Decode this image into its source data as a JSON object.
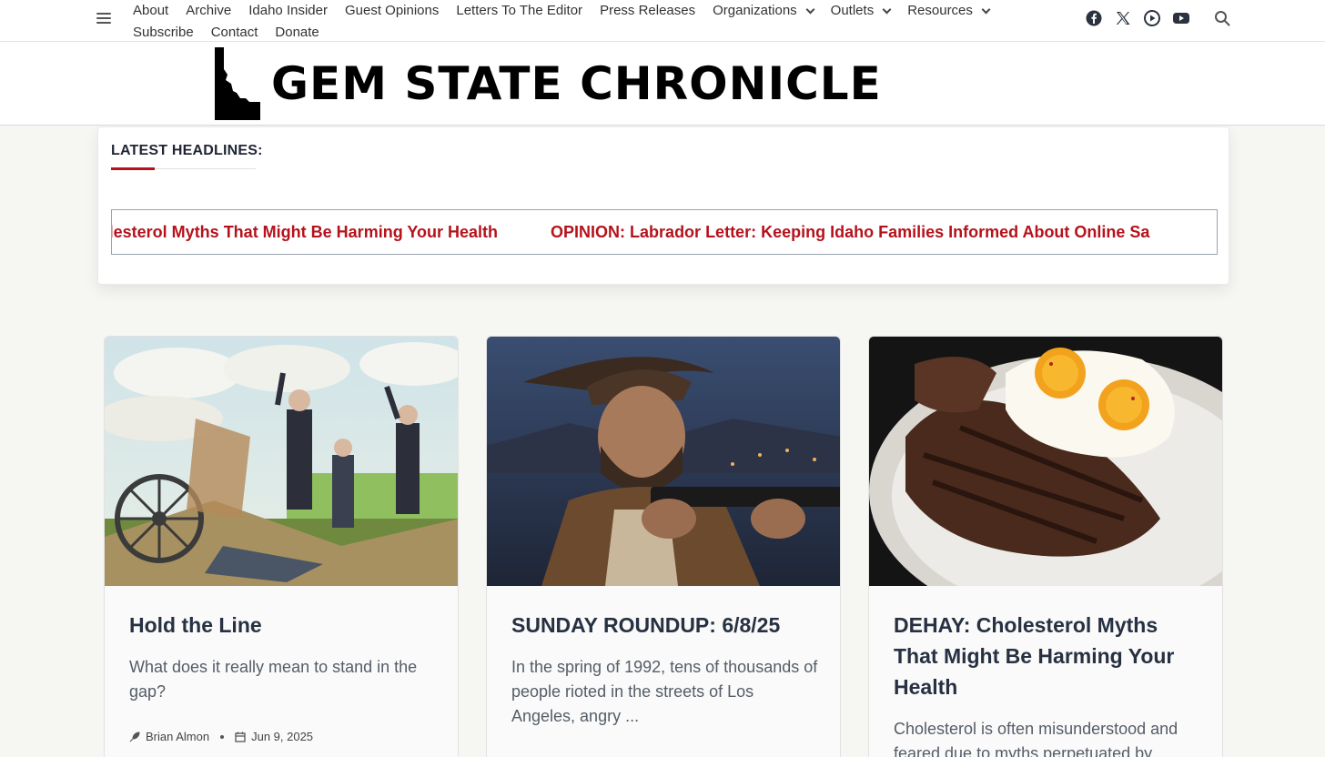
{
  "nav": {
    "menu": [
      {
        "label": "About",
        "dropdown": false
      },
      {
        "label": "Archive",
        "dropdown": false
      },
      {
        "label": "Idaho Insider",
        "dropdown": false
      },
      {
        "label": "Guest Opinions",
        "dropdown": false
      },
      {
        "label": "Letters To The Editor",
        "dropdown": false
      },
      {
        "label": "Press Releases",
        "dropdown": false
      },
      {
        "label": "Organizations",
        "dropdown": true
      },
      {
        "label": "Outlets",
        "dropdown": true
      },
      {
        "label": "Resources",
        "dropdown": true
      },
      {
        "label": "Subscribe",
        "dropdown": false
      },
      {
        "label": "Contact",
        "dropdown": false
      },
      {
        "label": "Donate",
        "dropdown": false
      }
    ],
    "socials": [
      "facebook-icon",
      "x-twitter-icon",
      "rumble-icon",
      "youtube-icon"
    ],
    "search_icon": "search-icon",
    "menu_icon": "hamburger-menu-icon"
  },
  "masthead": {
    "title": "GEM STATE CHRONICLE",
    "logo_icon": "idaho-state-silhouette-icon"
  },
  "ticker": {
    "label": "LATEST HEADLINES:",
    "items": [
      "Y: Cholesterol Myths That Might Be Harming Your Health",
      "OPINION: Labrador Letter: Keeping Idaho Families Informed About Online Sa"
    ]
  },
  "cards": [
    {
      "title": "Hold the Line",
      "excerpt": "What does it really mean to stand in the gap?",
      "author": "Brian Almon",
      "date": "Jun 9, 2025",
      "image": "historical-battle-illustration"
    },
    {
      "title": "SUNDAY ROUNDUP: 6/8/25",
      "excerpt": "In the spring of 1992, tens of thousands of people rioted in the streets of Los Angeles, angry ...",
      "image": "cowboy-with-rifle-at-night"
    },
    {
      "title": "DEHAY: Cholesterol Myths That Might Be Harming Your Health",
      "excerpt": "Cholesterol is often misunderstood and feared due to myths perpetuated by",
      "image": "steak-and-fried-eggs-plate"
    }
  ],
  "colors": {
    "accent_red": "#b5121b",
    "title_text": "#273142",
    "page_bg": "#f6f6f3"
  }
}
